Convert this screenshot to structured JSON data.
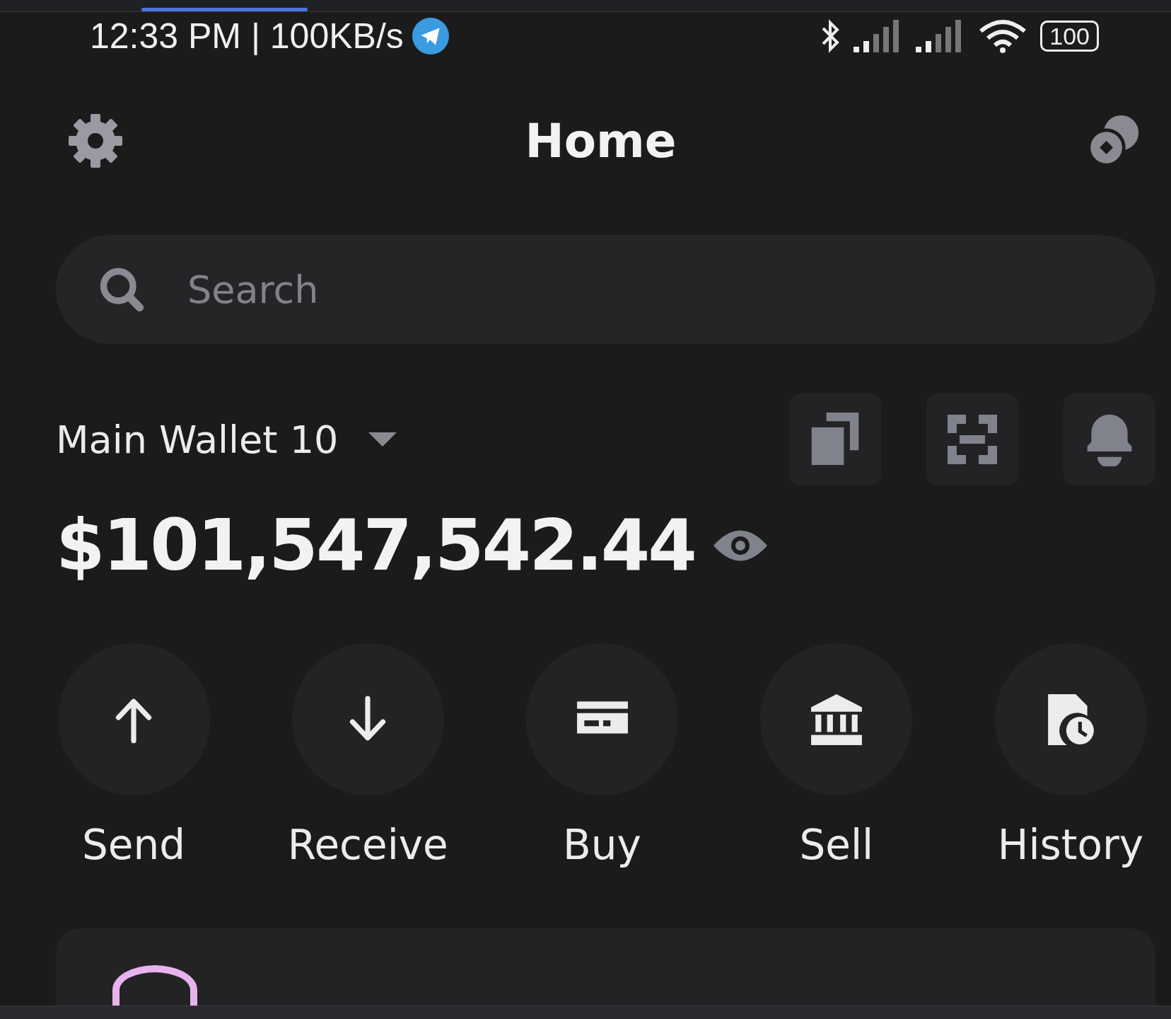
{
  "status_bar": {
    "text": "12:33 PM | 100KB/s",
    "battery": "100"
  },
  "header": {
    "title": "Home"
  },
  "search": {
    "placeholder": "Search"
  },
  "wallet": {
    "name": "Main Wallet 10",
    "balance": "$101,547,542.44"
  },
  "actions": [
    {
      "kind": "send",
      "label": "Send"
    },
    {
      "kind": "receive",
      "label": "Receive"
    },
    {
      "kind": "buy",
      "label": "Buy"
    },
    {
      "kind": "sell",
      "label": "Sell"
    },
    {
      "kind": "history",
      "label": "History"
    }
  ]
}
